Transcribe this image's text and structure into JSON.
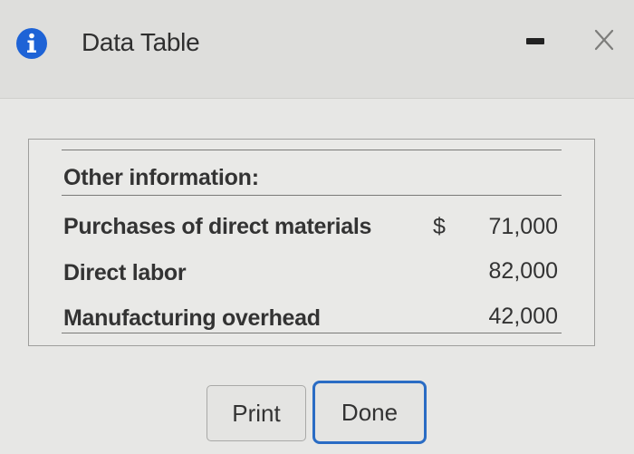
{
  "dialog": {
    "title": "Data Table",
    "icons": {
      "info": "info-icon",
      "minimize": "minimize-icon",
      "close": "close-icon"
    },
    "accent_color": "#2a6cc4"
  },
  "table": {
    "heading": "Other information:",
    "currency_symbol": "$",
    "rows": [
      {
        "label": "Purchases of direct materials",
        "value": "71,000"
      },
      {
        "label": "Direct labor",
        "value": "82,000"
      },
      {
        "label": "Manufacturing overhead",
        "value": "42,000"
      }
    ]
  },
  "buttons": {
    "print_label": "Print",
    "done_label": "Done"
  }
}
